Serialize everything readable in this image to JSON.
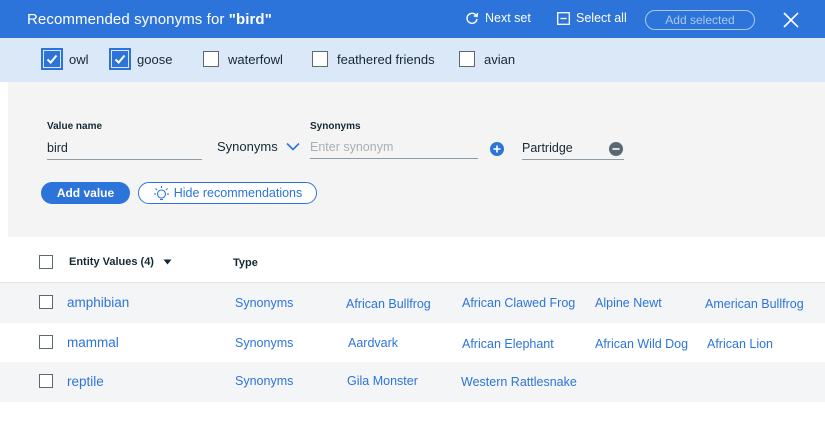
{
  "header": {
    "title_prefix": "Recommended synonyms for ",
    "title_term": "\"bird\"",
    "next_set": "Next set",
    "select_all": "Select all",
    "add_selected": "Add selected"
  },
  "suggestions": [
    {
      "label": "owl",
      "checked": true
    },
    {
      "label": "goose",
      "checked": true
    },
    {
      "label": "waterfowl",
      "checked": false
    },
    {
      "label": "feathered friends",
      "checked": false
    },
    {
      "label": "avian",
      "checked": false
    }
  ],
  "form": {
    "value_name_label": "Value name",
    "value_name": "bird",
    "type_select": "Synonyms",
    "synonyms_label": "Synonyms",
    "synonym_placeholder": "Enter synonym",
    "synonym_value": "Partridge",
    "add_value": "Add value",
    "hide_recommendations": "Hide recommendations"
  },
  "table": {
    "col_entity": "Entity Values (4)",
    "col_type": "Type",
    "rows": [
      {
        "name": "amphibian",
        "type": "Synonyms",
        "synonyms": [
          "African Bullfrog",
          "African Clawed Frog",
          "Alpine Newt",
          "American Bullfrog"
        ]
      },
      {
        "name": "mammal",
        "type": "Synonyms",
        "synonyms": [
          "Aardvark",
          "African Elephant",
          "African Wild Dog",
          "African Lion"
        ]
      },
      {
        "name": "reptile",
        "type": "Synonyms",
        "synonyms": [
          "Gila Monster",
          "Western Rattlesnake"
        ]
      }
    ]
  },
  "colors": {
    "accent": "#2d74da",
    "suggestion_bg": "#dbe8f7",
    "panel_bg": "#f4f4f4"
  }
}
